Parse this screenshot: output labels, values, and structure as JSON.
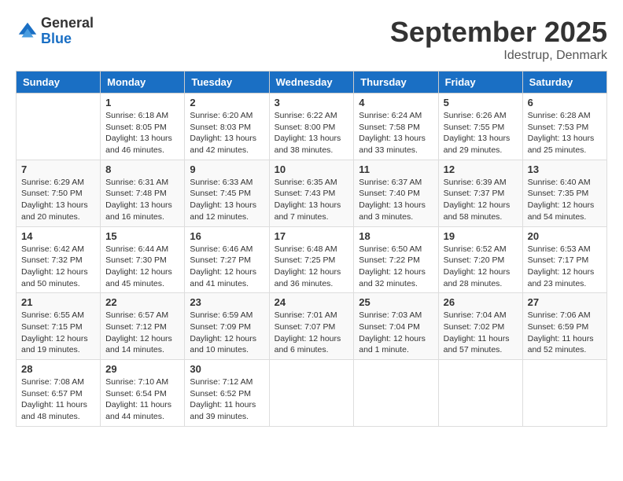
{
  "logo": {
    "general": "General",
    "blue": "Blue"
  },
  "title": {
    "month": "September 2025",
    "location": "Idestrup, Denmark"
  },
  "weekdays": [
    "Sunday",
    "Monday",
    "Tuesday",
    "Wednesday",
    "Thursday",
    "Friday",
    "Saturday"
  ],
  "weeks": [
    [
      {
        "day": "",
        "info": ""
      },
      {
        "day": "1",
        "info": "Sunrise: 6:18 AM\nSunset: 8:05 PM\nDaylight: 13 hours\nand 46 minutes."
      },
      {
        "day": "2",
        "info": "Sunrise: 6:20 AM\nSunset: 8:03 PM\nDaylight: 13 hours\nand 42 minutes."
      },
      {
        "day": "3",
        "info": "Sunrise: 6:22 AM\nSunset: 8:00 PM\nDaylight: 13 hours\nand 38 minutes."
      },
      {
        "day": "4",
        "info": "Sunrise: 6:24 AM\nSunset: 7:58 PM\nDaylight: 13 hours\nand 33 minutes."
      },
      {
        "day": "5",
        "info": "Sunrise: 6:26 AM\nSunset: 7:55 PM\nDaylight: 13 hours\nand 29 minutes."
      },
      {
        "day": "6",
        "info": "Sunrise: 6:28 AM\nSunset: 7:53 PM\nDaylight: 13 hours\nand 25 minutes."
      }
    ],
    [
      {
        "day": "7",
        "info": "Sunrise: 6:29 AM\nSunset: 7:50 PM\nDaylight: 13 hours\nand 20 minutes."
      },
      {
        "day": "8",
        "info": "Sunrise: 6:31 AM\nSunset: 7:48 PM\nDaylight: 13 hours\nand 16 minutes."
      },
      {
        "day": "9",
        "info": "Sunrise: 6:33 AM\nSunset: 7:45 PM\nDaylight: 13 hours\nand 12 minutes."
      },
      {
        "day": "10",
        "info": "Sunrise: 6:35 AM\nSunset: 7:43 PM\nDaylight: 13 hours\nand 7 minutes."
      },
      {
        "day": "11",
        "info": "Sunrise: 6:37 AM\nSunset: 7:40 PM\nDaylight: 13 hours\nand 3 minutes."
      },
      {
        "day": "12",
        "info": "Sunrise: 6:39 AM\nSunset: 7:37 PM\nDaylight: 12 hours\nand 58 minutes."
      },
      {
        "day": "13",
        "info": "Sunrise: 6:40 AM\nSunset: 7:35 PM\nDaylight: 12 hours\nand 54 minutes."
      }
    ],
    [
      {
        "day": "14",
        "info": "Sunrise: 6:42 AM\nSunset: 7:32 PM\nDaylight: 12 hours\nand 50 minutes."
      },
      {
        "day": "15",
        "info": "Sunrise: 6:44 AM\nSunset: 7:30 PM\nDaylight: 12 hours\nand 45 minutes."
      },
      {
        "day": "16",
        "info": "Sunrise: 6:46 AM\nSunset: 7:27 PM\nDaylight: 12 hours\nand 41 minutes."
      },
      {
        "day": "17",
        "info": "Sunrise: 6:48 AM\nSunset: 7:25 PM\nDaylight: 12 hours\nand 36 minutes."
      },
      {
        "day": "18",
        "info": "Sunrise: 6:50 AM\nSunset: 7:22 PM\nDaylight: 12 hours\nand 32 minutes."
      },
      {
        "day": "19",
        "info": "Sunrise: 6:52 AM\nSunset: 7:20 PM\nDaylight: 12 hours\nand 28 minutes."
      },
      {
        "day": "20",
        "info": "Sunrise: 6:53 AM\nSunset: 7:17 PM\nDaylight: 12 hours\nand 23 minutes."
      }
    ],
    [
      {
        "day": "21",
        "info": "Sunrise: 6:55 AM\nSunset: 7:15 PM\nDaylight: 12 hours\nand 19 minutes."
      },
      {
        "day": "22",
        "info": "Sunrise: 6:57 AM\nSunset: 7:12 PM\nDaylight: 12 hours\nand 14 minutes."
      },
      {
        "day": "23",
        "info": "Sunrise: 6:59 AM\nSunset: 7:09 PM\nDaylight: 12 hours\nand 10 minutes."
      },
      {
        "day": "24",
        "info": "Sunrise: 7:01 AM\nSunset: 7:07 PM\nDaylight: 12 hours\nand 6 minutes."
      },
      {
        "day": "25",
        "info": "Sunrise: 7:03 AM\nSunset: 7:04 PM\nDaylight: 12 hours\nand 1 minute."
      },
      {
        "day": "26",
        "info": "Sunrise: 7:04 AM\nSunset: 7:02 PM\nDaylight: 11 hours\nand 57 minutes."
      },
      {
        "day": "27",
        "info": "Sunrise: 7:06 AM\nSunset: 6:59 PM\nDaylight: 11 hours\nand 52 minutes."
      }
    ],
    [
      {
        "day": "28",
        "info": "Sunrise: 7:08 AM\nSunset: 6:57 PM\nDaylight: 11 hours\nand 48 minutes."
      },
      {
        "day": "29",
        "info": "Sunrise: 7:10 AM\nSunset: 6:54 PM\nDaylight: 11 hours\nand 44 minutes."
      },
      {
        "day": "30",
        "info": "Sunrise: 7:12 AM\nSunset: 6:52 PM\nDaylight: 11 hours\nand 39 minutes."
      },
      {
        "day": "",
        "info": ""
      },
      {
        "day": "",
        "info": ""
      },
      {
        "day": "",
        "info": ""
      },
      {
        "day": "",
        "info": ""
      }
    ]
  ]
}
